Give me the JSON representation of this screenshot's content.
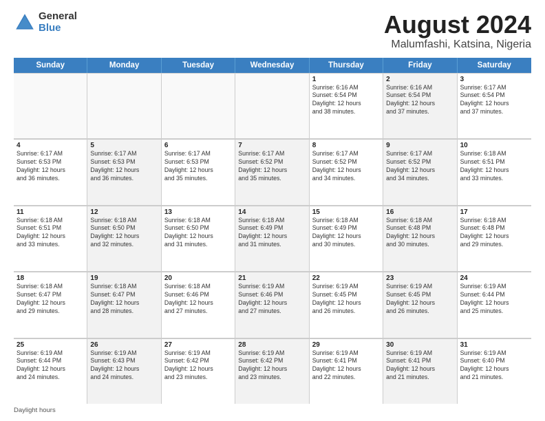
{
  "header": {
    "logo_general": "General",
    "logo_blue": "Blue",
    "main_title": "August 2024",
    "subtitle": "Malumfashi, Katsina, Nigeria"
  },
  "days_of_week": [
    "Sunday",
    "Monday",
    "Tuesday",
    "Wednesday",
    "Thursday",
    "Friday",
    "Saturday"
  ],
  "footer_text": "Daylight hours",
  "weeks": [
    [
      {
        "day": "",
        "text": "",
        "empty": true
      },
      {
        "day": "",
        "text": "",
        "empty": true
      },
      {
        "day": "",
        "text": "",
        "empty": true
      },
      {
        "day": "",
        "text": "",
        "empty": true
      },
      {
        "day": "1",
        "text": "Sunrise: 6:16 AM\nSunset: 6:54 PM\nDaylight: 12 hours\nand 38 minutes.",
        "empty": false,
        "shaded": false
      },
      {
        "day": "2",
        "text": "Sunrise: 6:16 AM\nSunset: 6:54 PM\nDaylight: 12 hours\nand 37 minutes.",
        "empty": false,
        "shaded": true
      },
      {
        "day": "3",
        "text": "Sunrise: 6:17 AM\nSunset: 6:54 PM\nDaylight: 12 hours\nand 37 minutes.",
        "empty": false,
        "shaded": false
      }
    ],
    [
      {
        "day": "4",
        "text": "Sunrise: 6:17 AM\nSunset: 6:53 PM\nDaylight: 12 hours\nand 36 minutes.",
        "empty": false,
        "shaded": false
      },
      {
        "day": "5",
        "text": "Sunrise: 6:17 AM\nSunset: 6:53 PM\nDaylight: 12 hours\nand 36 minutes.",
        "empty": false,
        "shaded": true
      },
      {
        "day": "6",
        "text": "Sunrise: 6:17 AM\nSunset: 6:53 PM\nDaylight: 12 hours\nand 35 minutes.",
        "empty": false,
        "shaded": false
      },
      {
        "day": "7",
        "text": "Sunrise: 6:17 AM\nSunset: 6:52 PM\nDaylight: 12 hours\nand 35 minutes.",
        "empty": false,
        "shaded": true
      },
      {
        "day": "8",
        "text": "Sunrise: 6:17 AM\nSunset: 6:52 PM\nDaylight: 12 hours\nand 34 minutes.",
        "empty": false,
        "shaded": false
      },
      {
        "day": "9",
        "text": "Sunrise: 6:17 AM\nSunset: 6:52 PM\nDaylight: 12 hours\nand 34 minutes.",
        "empty": false,
        "shaded": true
      },
      {
        "day": "10",
        "text": "Sunrise: 6:18 AM\nSunset: 6:51 PM\nDaylight: 12 hours\nand 33 minutes.",
        "empty": false,
        "shaded": false
      }
    ],
    [
      {
        "day": "11",
        "text": "Sunrise: 6:18 AM\nSunset: 6:51 PM\nDaylight: 12 hours\nand 33 minutes.",
        "empty": false,
        "shaded": false
      },
      {
        "day": "12",
        "text": "Sunrise: 6:18 AM\nSunset: 6:50 PM\nDaylight: 12 hours\nand 32 minutes.",
        "empty": false,
        "shaded": true
      },
      {
        "day": "13",
        "text": "Sunrise: 6:18 AM\nSunset: 6:50 PM\nDaylight: 12 hours\nand 31 minutes.",
        "empty": false,
        "shaded": false
      },
      {
        "day": "14",
        "text": "Sunrise: 6:18 AM\nSunset: 6:49 PM\nDaylight: 12 hours\nand 31 minutes.",
        "empty": false,
        "shaded": true
      },
      {
        "day": "15",
        "text": "Sunrise: 6:18 AM\nSunset: 6:49 PM\nDaylight: 12 hours\nand 30 minutes.",
        "empty": false,
        "shaded": false
      },
      {
        "day": "16",
        "text": "Sunrise: 6:18 AM\nSunset: 6:48 PM\nDaylight: 12 hours\nand 30 minutes.",
        "empty": false,
        "shaded": true
      },
      {
        "day": "17",
        "text": "Sunrise: 6:18 AM\nSunset: 6:48 PM\nDaylight: 12 hours\nand 29 minutes.",
        "empty": false,
        "shaded": false
      }
    ],
    [
      {
        "day": "18",
        "text": "Sunrise: 6:18 AM\nSunset: 6:47 PM\nDaylight: 12 hours\nand 29 minutes.",
        "empty": false,
        "shaded": false
      },
      {
        "day": "19",
        "text": "Sunrise: 6:18 AM\nSunset: 6:47 PM\nDaylight: 12 hours\nand 28 minutes.",
        "empty": false,
        "shaded": true
      },
      {
        "day": "20",
        "text": "Sunrise: 6:18 AM\nSunset: 6:46 PM\nDaylight: 12 hours\nand 27 minutes.",
        "empty": false,
        "shaded": false
      },
      {
        "day": "21",
        "text": "Sunrise: 6:19 AM\nSunset: 6:46 PM\nDaylight: 12 hours\nand 27 minutes.",
        "empty": false,
        "shaded": true
      },
      {
        "day": "22",
        "text": "Sunrise: 6:19 AM\nSunset: 6:45 PM\nDaylight: 12 hours\nand 26 minutes.",
        "empty": false,
        "shaded": false
      },
      {
        "day": "23",
        "text": "Sunrise: 6:19 AM\nSunset: 6:45 PM\nDaylight: 12 hours\nand 26 minutes.",
        "empty": false,
        "shaded": true
      },
      {
        "day": "24",
        "text": "Sunrise: 6:19 AM\nSunset: 6:44 PM\nDaylight: 12 hours\nand 25 minutes.",
        "empty": false,
        "shaded": false
      }
    ],
    [
      {
        "day": "25",
        "text": "Sunrise: 6:19 AM\nSunset: 6:44 PM\nDaylight: 12 hours\nand 24 minutes.",
        "empty": false,
        "shaded": false
      },
      {
        "day": "26",
        "text": "Sunrise: 6:19 AM\nSunset: 6:43 PM\nDaylight: 12 hours\nand 24 minutes.",
        "empty": false,
        "shaded": true
      },
      {
        "day": "27",
        "text": "Sunrise: 6:19 AM\nSunset: 6:42 PM\nDaylight: 12 hours\nand 23 minutes.",
        "empty": false,
        "shaded": false
      },
      {
        "day": "28",
        "text": "Sunrise: 6:19 AM\nSunset: 6:42 PM\nDaylight: 12 hours\nand 23 minutes.",
        "empty": false,
        "shaded": true
      },
      {
        "day": "29",
        "text": "Sunrise: 6:19 AM\nSunset: 6:41 PM\nDaylight: 12 hours\nand 22 minutes.",
        "empty": false,
        "shaded": false
      },
      {
        "day": "30",
        "text": "Sunrise: 6:19 AM\nSunset: 6:41 PM\nDaylight: 12 hours\nand 21 minutes.",
        "empty": false,
        "shaded": true
      },
      {
        "day": "31",
        "text": "Sunrise: 6:19 AM\nSunset: 6:40 PM\nDaylight: 12 hours\nand 21 minutes.",
        "empty": false,
        "shaded": false
      }
    ]
  ]
}
